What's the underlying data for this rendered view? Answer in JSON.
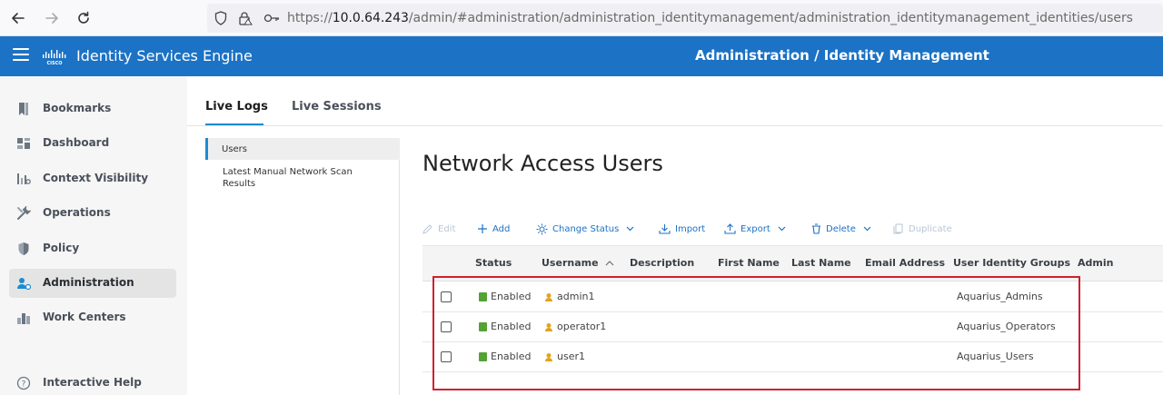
{
  "browser": {
    "url_prefix": "https://",
    "url_host": "10.0.64.243",
    "url_path": "/admin/#administration/administration_identitymanagement/administration_identitymanagement_identities/users"
  },
  "app": {
    "product_name": "Identity Services Engine",
    "header_title": "Administration / Identity Management"
  },
  "sidebar": {
    "items": [
      {
        "label": "Bookmarks",
        "icon": "bookmark-icon"
      },
      {
        "label": "Dashboard",
        "icon": "dashboard-icon"
      },
      {
        "label": "Context Visibility",
        "icon": "context-visibility-icon"
      },
      {
        "label": "Operations",
        "icon": "wrench-icon"
      },
      {
        "label": "Policy",
        "icon": "shield-icon"
      },
      {
        "label": "Administration",
        "icon": "admin-user-icon"
      },
      {
        "label": "Work Centers",
        "icon": "work-centers-icon"
      },
      {
        "label": "Interactive Help",
        "icon": "help-icon"
      }
    ],
    "active": "Administration"
  },
  "tabs": [
    {
      "label": "Live Logs"
    },
    {
      "label": "Live Sessions"
    }
  ],
  "subnav": {
    "items": [
      {
        "label": "Users"
      },
      {
        "label": "Latest Manual Network Scan Results"
      }
    ]
  },
  "page_title": "Network Access Users",
  "toolbar": {
    "edit": "Edit",
    "add": "Add",
    "change_status": "Change Status",
    "import": "Import",
    "export": "Export",
    "delete": "Delete",
    "duplicate": "Duplicate"
  },
  "table": {
    "columns": [
      "Status",
      "Username",
      "Description",
      "First Name",
      "Last Name",
      "Email Address",
      "User Identity Groups",
      "Admin"
    ],
    "rows": [
      {
        "status": "Enabled",
        "username": "admin1",
        "group": "Aquarius_Admins"
      },
      {
        "status": "Enabled",
        "username": "operator1",
        "group": "Aquarius_Operators"
      },
      {
        "status": "Enabled",
        "username": "user1",
        "group": "Aquarius_Users"
      }
    ]
  },
  "colors": {
    "header_blue": "#1c72c4",
    "accent_blue": "#1c8bd1",
    "status_green": "#52a334",
    "highlight_red": "#d0202e"
  }
}
